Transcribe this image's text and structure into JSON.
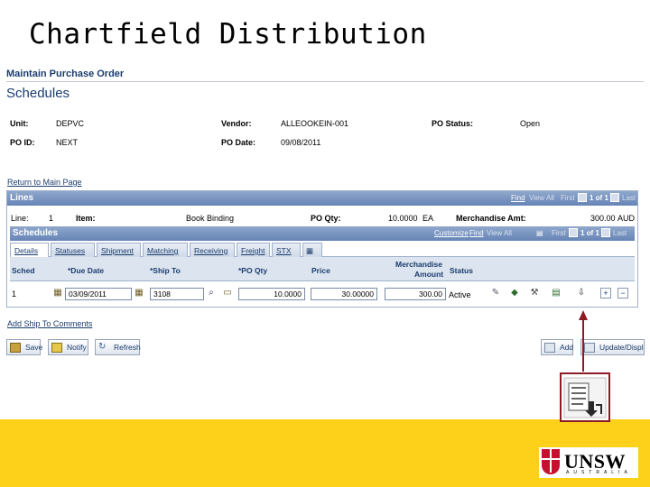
{
  "slide": {
    "title": "Chartfield Distribution"
  },
  "app": {
    "breadcrumb": "Maintain Purchase Order",
    "page_title": "Schedules",
    "header": {
      "unit_label": "Unit:",
      "unit_value": "DEPVC",
      "vendor_label": "Vendor:",
      "vendor_value": "ALLEOOKEIN-001",
      "po_status_label": "PO Status:",
      "po_status_value": "Open",
      "po_id_label": "PO ID:",
      "po_id_value": "NEXT",
      "po_date_label": "PO Date:",
      "po_date_value": "09/08/2011"
    },
    "return_link": "Return to Main Page",
    "lines": {
      "bar_title": "Lines",
      "find": "Find",
      "view_all": "View All",
      "first": "First",
      "count": "1 of 1",
      "last": "Last",
      "line_label": "Line:",
      "line_value": "1",
      "item_label": "Item:",
      "item_value": "Book Binding",
      "po_qty_label": "PO Qty:",
      "po_qty_value": "10.0000",
      "uom": "EA",
      "merch_amt_label": "Merchandise Amt:",
      "merch_amt_value": "300.00",
      "currency": "AUD"
    },
    "schedules": {
      "bar_title": "Schedules",
      "customize": "Customize",
      "find": "Find",
      "view_all": "View All",
      "first": "First",
      "count": "1 of 1",
      "last": "Last",
      "tabs": [
        "Details",
        "Statuses",
        "Shipment",
        "Matching",
        "Receiving",
        "Freight",
        "STX"
      ],
      "columns": {
        "sched": "Sched",
        "due_date": "*Due Date",
        "ship_to": "*Ship To",
        "po_qty": "*PO Qty",
        "price": "Price",
        "merch_amount_1": "Merchandise",
        "merch_amount_2": "Amount",
        "status": "Status"
      },
      "row": {
        "sched": "1",
        "due_date": "03/09/2011",
        "ship_to": "3108",
        "po_qty": "10.0000",
        "price": "30.00000",
        "merch_amount": "300.00",
        "status": "Active"
      }
    },
    "add_ship_to_comments": "Add Ship To Comments",
    "buttons": {
      "save": "Save",
      "notify": "Notify",
      "refresh": "Refresh",
      "add": "Add",
      "update_display": "Update/Display"
    }
  },
  "colors": {
    "footer": "#fdd01a",
    "accent": "#1b3d6e",
    "arrow": "#8b1c24"
  },
  "branding": {
    "logo_text": "UNSW",
    "logo_sub": "AUSTRALIA"
  }
}
